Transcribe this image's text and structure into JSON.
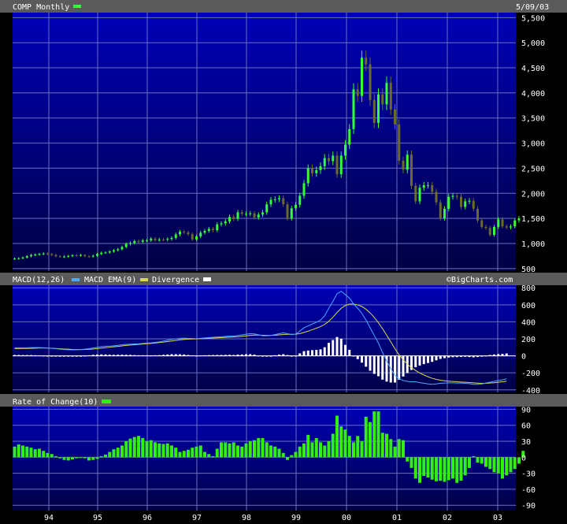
{
  "header": {
    "title": "COMP Monthly",
    "date": "5/09/03"
  },
  "colors": {
    "background": "#000033",
    "panel_top": "#0000b0",
    "panel_bottom": "#000040",
    "grid": "#6a6fbf",
    "header_bar": "#5a5a5a",
    "text": "#ffffff",
    "up_candle": "#33ff33",
    "down_candle": "#6b6b2a",
    "macd_line": "#4aa8ff",
    "ema_line": "#d8d850",
    "divergence": "#ffffff",
    "roc_bar": "#33ee11"
  },
  "panels": {
    "price": {
      "label": "COMP Monthly",
      "legend_swatch": "up_candle"
    },
    "macd": {
      "label": "MACD(12,26)",
      "ema_label": "MACD EMA(9)",
      "div_label": "Divergence",
      "watermark": "©BigCharts.com"
    },
    "roc": {
      "label": "Rate of Change(10)"
    }
  },
  "chart_data": [
    {
      "type": "candlestick",
      "title": "COMP Monthly",
      "x_tick_labels": [
        "94",
        "95",
        "96",
        "97",
        "98",
        "99",
        "00",
        "01",
        "02",
        "03"
      ],
      "y_ticks": [
        "500",
        "1,000",
        "1,500",
        "2,000",
        "2,500",
        "3,000",
        "3,500",
        "4,000",
        "4,500",
        "5,000",
        "5,500"
      ],
      "ylim": [
        450,
        5600
      ],
      "x_start": "1993-06",
      "grid": true,
      "candles": [
        [
          690,
          700
        ],
        [
          700,
          705
        ],
        [
          705,
          720
        ],
        [
          720,
          745
        ],
        [
          745,
          770
        ],
        [
          770,
          780
        ],
        [
          780,
          790
        ],
        [
          790,
          800
        ],
        [
          800,
          790
        ],
        [
          790,
          770
        ],
        [
          770,
          745
        ],
        [
          745,
          735
        ],
        [
          735,
          740
        ],
        [
          740,
          750
        ],
        [
          750,
          765
        ],
        [
          765,
          760
        ],
        [
          760,
          770
        ],
        [
          770,
          745
        ],
        [
          745,
          740
        ],
        [
          740,
          755
        ],
        [
          755,
          790
        ],
        [
          790,
          815
        ],
        [
          815,
          820
        ],
        [
          820,
          840
        ],
        [
          840,
          865
        ],
        [
          865,
          885
        ],
        [
          885,
          930
        ],
        [
          930,
          990
        ],
        [
          990,
          1010
        ],
        [
          1010,
          1045
        ],
        [
          1045,
          1035
        ],
        [
          1035,
          1060
        ],
        [
          1060,
          1060
        ],
        [
          1060,
          1095
        ],
        [
          1095,
          1065
        ],
        [
          1065,
          1080
        ],
        [
          1080,
          1075
        ],
        [
          1075,
          1090
        ],
        [
          1090,
          1110
        ],
        [
          1110,
          1180
        ],
        [
          1180,
          1235
        ],
        [
          1235,
          1220
        ],
        [
          1220,
          1185
        ],
        [
          1185,
          1080
        ],
        [
          1080,
          1140
        ],
        [
          1140,
          1215
        ],
        [
          1215,
          1250
        ],
        [
          1250,
          1290
        ],
        [
          1290,
          1265
        ],
        [
          1265,
          1380
        ],
        [
          1380,
          1400
        ],
        [
          1400,
          1440
        ],
        [
          1440,
          1530
        ],
        [
          1530,
          1490
        ],
        [
          1490,
          1620
        ],
        [
          1620,
          1590
        ],
        [
          1590,
          1590
        ],
        [
          1590,
          1600
        ],
        [
          1600,
          1520
        ],
        [
          1520,
          1575
        ],
        [
          1575,
          1620
        ],
        [
          1620,
          1780
        ],
        [
          1780,
          1870
        ],
        [
          1870,
          1880
        ],
        [
          1880,
          1900
        ],
        [
          1900,
          1780
        ],
        [
          1780,
          1500
        ],
        [
          1500,
          1700
        ],
        [
          1700,
          1770
        ],
        [
          1770,
          1950
        ],
        [
          1950,
          2200
        ],
        [
          2200,
          2500
        ],
        [
          2500,
          2400
        ],
        [
          2400,
          2460
        ],
        [
          2460,
          2540
        ],
        [
          2540,
          2700
        ],
        [
          2700,
          2640
        ],
        [
          2640,
          2750
        ],
        [
          2750,
          2380
        ],
        [
          2380,
          2750
        ],
        [
          2750,
          2970
        ],
        [
          2970,
          3280
        ],
        [
          3280,
          4070
        ],
        [
          4070,
          3940
        ],
        [
          3940,
          4700
        ],
        [
          4700,
          4570
        ],
        [
          4570,
          3860
        ],
        [
          3860,
          3400
        ],
        [
          3400,
          3970
        ],
        [
          3970,
          3770
        ],
        [
          3770,
          4200
        ],
        [
          4200,
          3670
        ],
        [
          3670,
          3370
        ],
        [
          3370,
          2650
        ],
        [
          2650,
          2470
        ],
        [
          2470,
          2770
        ],
        [
          2770,
          2150
        ],
        [
          2150,
          1840
        ],
        [
          1840,
          2110
        ],
        [
          2110,
          2160
        ],
        [
          2160,
          2160
        ],
        [
          2160,
          2030
        ],
        [
          2030,
          1820
        ],
        [
          1820,
          1500
        ],
        [
          1500,
          1690
        ],
        [
          1690,
          1930
        ],
        [
          1930,
          1950
        ],
        [
          1950,
          1930
        ],
        [
          1930,
          1730
        ],
        [
          1730,
          1840
        ],
        [
          1840,
          1850
        ],
        [
          1850,
          1690
        ],
        [
          1690,
          1460
        ],
        [
          1460,
          1330
        ],
        [
          1330,
          1310
        ],
        [
          1310,
          1170
        ],
        [
          1170,
          1330
        ],
        [
          1330,
          1480
        ],
        [
          1480,
          1340
        ],
        [
          1340,
          1320
        ],
        [
          1320,
          1340
        ],
        [
          1340,
          1460
        ],
        [
          1460,
          1500
        ]
      ],
      "series": [
        {
          "name": "COMP Monthly"
        }
      ]
    },
    {
      "type": "line",
      "title": "MACD(12,26)",
      "y_ticks": [
        "800",
        "600",
        "400",
        "200",
        "0",
        "-200",
        "-400"
      ],
      "ylim": [
        -430,
        830
      ],
      "series": [
        {
          "name": "MACD(12,26)",
          "values": [
            95,
            95,
            95,
            95,
            97,
            97,
            97,
            95,
            92,
            88,
            84,
            78,
            74,
            72,
            70,
            72,
            74,
            78,
            84,
            92,
            100,
            108,
            112,
            114,
            118,
            124,
            130,
            134,
            138,
            140,
            142,
            146,
            150,
            152,
            158,
            164,
            174,
            184,
            194,
            200,
            206,
            208,
            206,
            204,
            202,
            206,
            210,
            214,
            218,
            222,
            224,
            228,
            232,
            232,
            240,
            246,
            254,
            260,
            258,
            248,
            236,
            236,
            240,
            250,
            260,
            270,
            262,
            250,
            256,
            290,
            330,
            352,
            374,
            395,
            420,
            470,
            560,
            640,
            730,
            760,
            720,
            680,
            610,
            560,
            500,
            420,
            330,
            240,
            150,
            40,
            -60,
            -150,
            -230,
            -270,
            -290,
            -300,
            -305,
            -305,
            -315,
            -322,
            -330,
            -335,
            -330,
            -322,
            -320,
            -318,
            -318,
            -320,
            -320,
            -322,
            -328,
            -335,
            -335,
            -330,
            -320,
            -310,
            -300,
            -290,
            -282,
            -270
          ]
        },
        {
          "name": "MACD EMA(9)",
          "values": [
            85,
            85,
            86,
            86,
            88,
            90,
            92,
            92,
            91,
            89,
            86,
            83,
            80,
            78,
            75,
            74,
            74,
            75,
            77,
            80,
            85,
            91,
            96,
            101,
            106,
            111,
            117,
            122,
            127,
            131,
            135,
            139,
            143,
            146,
            151,
            156,
            162,
            168,
            175,
            181,
            188,
            193,
            196,
            198,
            199,
            201,
            203,
            206,
            209,
            212,
            214,
            217,
            220,
            222,
            226,
            230,
            235,
            240,
            244,
            244,
            242,
            241,
            241,
            243,
            246,
            251,
            253,
            253,
            254,
            261,
            275,
            290,
            307,
            325,
            344,
            369,
            407,
            454,
            509,
            559,
            591,
            609,
            609,
            599,
            580,
            548,
            505,
            452,
            390,
            320,
            243,
            164,
            84,
            12,
            -47,
            -97,
            -139,
            -172,
            -201,
            -225,
            -246,
            -264,
            -277,
            -286,
            -293,
            -298,
            -302,
            -305,
            -308,
            -311,
            -314,
            -318,
            -321,
            -323,
            -323,
            -320,
            -316,
            -311,
            -305,
            -298
          ]
        },
        {
          "name": "Divergence",
          "values": [
            10,
            10,
            9,
            9,
            9,
            7,
            5,
            3,
            1,
            -1,
            -2,
            -5,
            -6,
            -6,
            -5,
            -2,
            0,
            3,
            7,
            12,
            15,
            17,
            16,
            13,
            12,
            13,
            13,
            12,
            11,
            9,
            7,
            7,
            7,
            6,
            7,
            8,
            12,
            16,
            19,
            19,
            18,
            15,
            10,
            6,
            3,
            5,
            7,
            8,
            9,
            10,
            10,
            11,
            12,
            10,
            14,
            16,
            19,
            20,
            14,
            4,
            -6,
            -5,
            -1,
            7,
            14,
            19,
            9,
            -3,
            2,
            29,
            55,
            62,
            67,
            70,
            76,
            101,
            153,
            186,
            221,
            201,
            129,
            71,
            1,
            -39,
            -80,
            -128,
            -175,
            -212,
            -240,
            -280,
            -303,
            -314,
            -314,
            -282,
            -243,
            -203,
            -166,
            -133,
            -114,
            -97,
            -84,
            -71,
            -53,
            -36,
            -27,
            -20,
            -16,
            -15,
            -12,
            -11,
            -14,
            -17,
            -14,
            -7,
            3,
            10,
            16,
            21,
            23,
            28
          ]
        }
      ]
    },
    {
      "type": "bar",
      "title": "Rate of Change(10)",
      "y_ticks": [
        "90",
        "60",
        "30",
        "0",
        "-30",
        "-60",
        "-90"
      ],
      "ylim": [
        -100,
        95
      ],
      "series": [
        {
          "name": "Rate of Change(10)",
          "values": [
            20,
            24,
            22,
            20,
            18,
            15,
            16,
            12,
            8,
            6,
            2,
            -2,
            -5,
            -6,
            -4,
            -2,
            0,
            -2,
            -6,
            -5,
            -3,
            2,
            5,
            10,
            15,
            18,
            22,
            30,
            35,
            38,
            40,
            36,
            30,
            32,
            28,
            26,
            25,
            26,
            22,
            18,
            10,
            12,
            14,
            18,
            20,
            22,
            10,
            6,
            2,
            16,
            28,
            28,
            26,
            28,
            22,
            20,
            26,
            30,
            32,
            36,
            36,
            28,
            22,
            20,
            16,
            8,
            -5,
            4,
            10,
            20,
            26,
            42,
            28,
            36,
            28,
            22,
            30,
            44,
            78,
            58,
            52,
            40,
            28,
            40,
            30,
            76,
            66,
            86,
            86,
            46,
            44,
            34,
            20,
            34,
            32,
            -8,
            -20,
            -40,
            -48,
            -35,
            -38,
            -42,
            -45,
            -44,
            -46,
            -43,
            -40,
            -48,
            -44,
            -34,
            -20,
            2,
            -10,
            -12,
            -18,
            -22,
            -28,
            -30,
            -40,
            -34,
            -28,
            -22,
            -12,
            12
          ]
        }
      ]
    }
  ]
}
